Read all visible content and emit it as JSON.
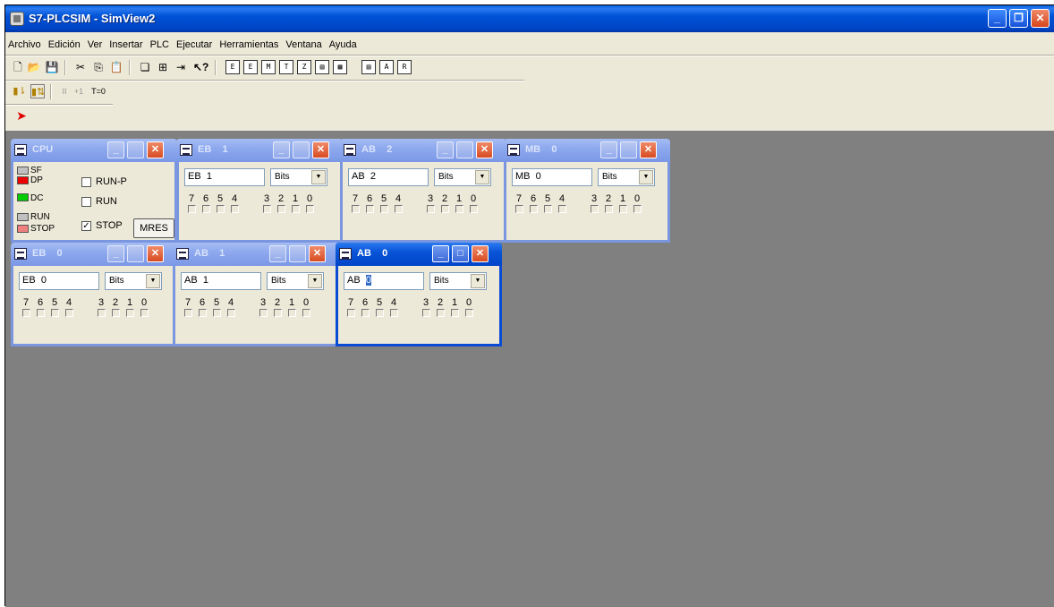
{
  "window": {
    "title": "S7-PLCSIM - SimView2",
    "min_label": "_",
    "restore_label": "❐",
    "close_label": "✕"
  },
  "menu": [
    "Archivo",
    "Edición",
    "Ver",
    "Insertar",
    "PLC",
    "Ejecutar",
    "Herramientas",
    "Ventana",
    "Ayuda"
  ],
  "toolbar1": {
    "icons": [
      "new-file-icon",
      "open-folder-icon",
      "save-icon",
      "cut-icon",
      "copy-icon",
      "paste-icon",
      "cascade-icon",
      "tile-icon",
      "pin-icon",
      "context-help-icon",
      "insert-input-icon",
      "insert-output-icon",
      "insert-marker-icon",
      "insert-timer-icon",
      "insert-counter-icon",
      "insert-generic-icon",
      "insert-vertical-bits-icon",
      "insert-stack-icon",
      "insert-accu-icon",
      "insert-block-regs-icon"
    ],
    "square_letters": [
      "E",
      "E",
      "M",
      "T",
      "Z",
      "▤",
      "▦",
      "▤",
      "A",
      "R"
    ]
  },
  "toolbar2": {
    "icons": [
      "single-scan-icon",
      "continuous-scan-icon",
      "pause-icon",
      "next-scan-icon",
      "reset-timers-icon"
    ],
    "pause_label": "II",
    "next_label": "+1",
    "timer_label": "T=0"
  },
  "toolbar3": {
    "icons": [
      "pointer-red-icon"
    ]
  },
  "colors": {
    "led_sf": "#c0c0c0",
    "led_dp": "#ee0000",
    "led_dc": "#00cc00",
    "led_run": "#c0c0c0",
    "led_stop": "#f08080",
    "mdi_background": "#808080"
  },
  "cpu": {
    "title": "CPU",
    "leds": [
      "SF",
      "DP",
      "DC",
      "RUN",
      "STOP"
    ],
    "modes": [
      {
        "label": "RUN-P",
        "checked": false
      },
      {
        "label": "RUN",
        "checked": false
      },
      {
        "label": "STOP",
        "checked": true
      }
    ],
    "mres_label": "MRES"
  },
  "bit_numbers": [
    "7",
    "6",
    "5",
    "4",
    "3",
    "2",
    "1",
    "0"
  ],
  "format_option": "Bits",
  "windows": [
    {
      "title": "EB    1",
      "addr_prefix": "EB",
      "addr_number": "1",
      "active": false
    },
    {
      "title": "AB    2",
      "addr_prefix": "AB",
      "addr_number": "2",
      "active": false
    },
    {
      "title": "MB    0",
      "addr_prefix": "MB",
      "addr_number": "0",
      "active": false
    },
    {
      "title": "EB    0",
      "addr_prefix": "EB",
      "addr_number": "0",
      "active": false
    },
    {
      "title": "AB    1",
      "addr_prefix": "AB",
      "addr_number": "1",
      "active": false
    },
    {
      "title": "AB    0",
      "addr_prefix": "AB",
      "addr_number": "0",
      "active": true
    }
  ]
}
